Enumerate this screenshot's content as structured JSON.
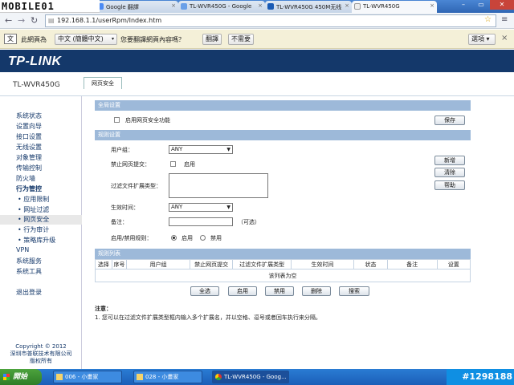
{
  "browser": {
    "tabs": [
      {
        "label": "Google 翻譯"
      },
      {
        "label": "TL-WVR450G - Google"
      },
      {
        "label": "TL-WVR450G 450M无线"
      },
      {
        "label": "TL-WVR450G"
      }
    ],
    "url": "192.168.1.1/userRpm/Index.htm",
    "watermark": "MOBILE01"
  },
  "translate_bar": {
    "text1": "此網頁為",
    "language": "中文 (簡體中文)",
    "text2": "您要翻譯網頁內容嗎？",
    "translate_btn": "翻譯",
    "no_btn": "不需要",
    "options_btn": "選項"
  },
  "header": {
    "brand": "TP-LINK",
    "model": "TL-WVR450G",
    "page_tab": "网页安全"
  },
  "sidebar": {
    "items": [
      {
        "label": "系统状态"
      },
      {
        "label": "设置向导"
      },
      {
        "label": "接口设置"
      },
      {
        "label": "无线设置"
      },
      {
        "label": "对象管理"
      },
      {
        "label": "传输控制"
      },
      {
        "label": "防火墙"
      },
      {
        "label": "行为管控"
      },
      {
        "label": "• 应用限制"
      },
      {
        "label": "• 网址过滤"
      },
      {
        "label": "• 网页安全"
      },
      {
        "label": "• 行为审计"
      },
      {
        "label": "• 策略库升级"
      },
      {
        "label": "VPN"
      },
      {
        "label": "系统服务"
      },
      {
        "label": "系统工具"
      },
      {
        "label": "退出登录"
      }
    ],
    "copyright1": "Copyright © 2012",
    "copyright2": "深圳市普联技术有限公司",
    "copyright3": "版权所有"
  },
  "global": {
    "title": "全局设置",
    "enable_label": "启用网页安全功能",
    "save_btn": "保存"
  },
  "rule": {
    "title": "规则设置",
    "user_group_label": "用户组：",
    "user_group_value": "ANY",
    "block_submit_label": "禁止网页提交：",
    "block_submit_enable": "启用",
    "ext_label": "过滤文件扩展类型：",
    "time_label": "生效时间：",
    "time_value": "ANY",
    "note_label": "备注：",
    "optional": "（可选）",
    "state_label": "启用/禁用规则：",
    "enable": "启用",
    "disable": "禁用",
    "add_btn": "新增",
    "clear_btn": "清除",
    "help_btn": "帮助"
  },
  "list": {
    "title": "规则列表",
    "columns": [
      "选择",
      "序号",
      "用户组",
      "禁止网页提交",
      "过滤文件扩展类型",
      "生效时间",
      "状态",
      "备注",
      "设置"
    ],
    "empty": "该列表为空",
    "buttons": [
      "全选",
      "启用",
      "禁用",
      "删除",
      "搜索"
    ]
  },
  "notes": {
    "title": "注意：",
    "line1": "1. 您可以在过滤文件扩展类型框内输入多个扩展名，并以空格、逗号或者回车执行来分隔。"
  },
  "taskbar": {
    "start": "開始",
    "tasks": [
      {
        "label": "006 - 小畫家"
      },
      {
        "label": "028 - 小畫家"
      },
      {
        "label": "TL-WVR450G - Goog..."
      }
    ],
    "tray": "#1298188"
  }
}
